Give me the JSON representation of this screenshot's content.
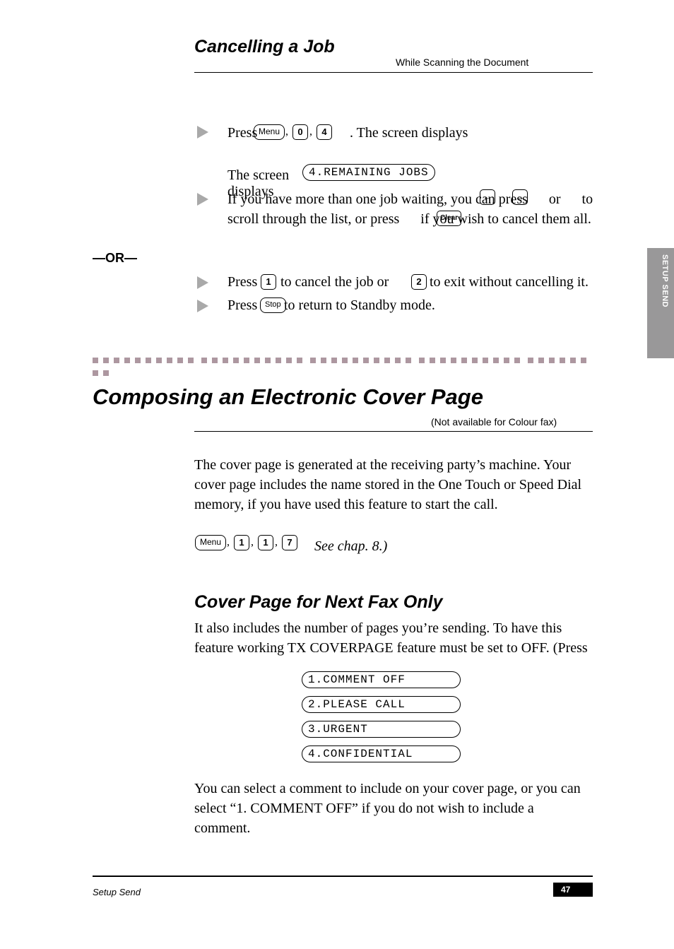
{
  "sideTab": "SETUP SEND",
  "cancel": {
    "heading": "Cancelling a Job",
    "headingSub": "While Scanning the Document",
    "step1_press": "Press",
    "step1_rest": ". The screen displays",
    "key_menu": "Menu",
    "key_0": "0",
    "key_4": "4",
    "lcd_remaining": "4.REMAINING JOBS",
    "step2a": "The screen displays",
    "step2b": "If you have more than one job waiting, you can press      or      to scroll through the list, or press      if you wish to cancel them all.",
    "arrow_left": "←",
    "arrow_right": "→",
    "clear": "Clear",
    "or_dash": "—OR—",
    "step3a": "Press",
    "key_1": "1",
    "step3b": " to cancel the job or ",
    "key_2": "2",
    "step3c": " to exit without cancelling it.",
    "step4a": "Press",
    "key_stop": "Stop",
    "step4b": " to return to Standby mode."
  },
  "compose": {
    "heading": "Composing an Electronic Cover Page",
    "headingSub": "(Not available for Colour fax)",
    "para1a": "The cover page is generated at the receiving party’s machine. Your cover page includes the name stored in the One Touch or Speed Dial memory, if you have used this feature to start the call.",
    "para1b": " See chap. 8.)",
    "key_menu": "Menu",
    "keys_117": [
      "1",
      "1",
      "7"
    ],
    "coverHead": "Cover Page for Next Fax Only",
    "para2": "It also includes the number of pages you’re sending. To have this feature working TX COVERPAGE feature must be set to OFF. (Press ",
    "lcd": [
      "1.COMMENT OFF",
      "2.PLEASE CALL",
      "3.URGENT",
      "4.CONFIDENTIAL"
    ],
    "para3": "You can select a comment to include on your cover page, or you can select “1. COMMENT OFF” if you do not wish to include a comment."
  },
  "footer": {
    "left": "Setup Send",
    "page": "47"
  }
}
